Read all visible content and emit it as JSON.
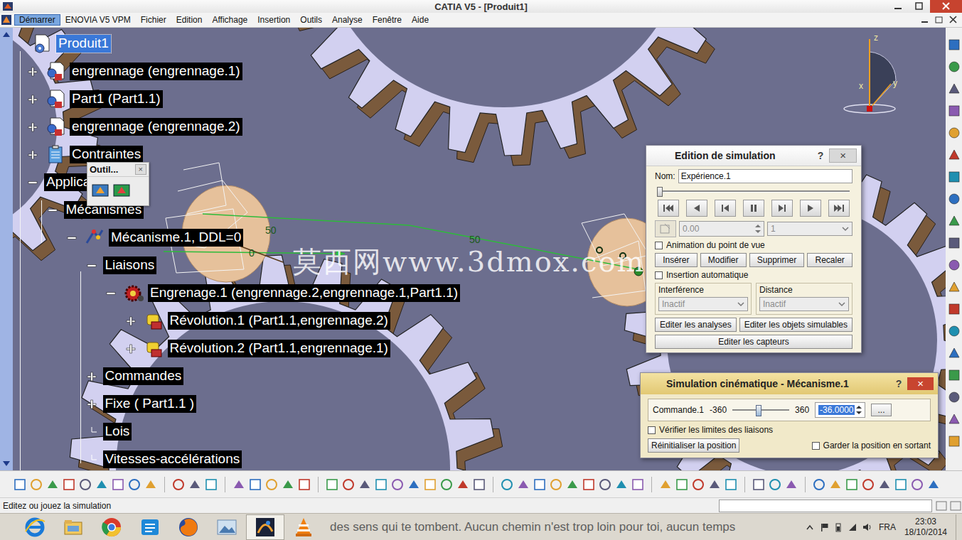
{
  "window": {
    "title": "CATIA V5 - [Produit1]"
  },
  "menu": [
    {
      "label": "Démarrer",
      "selected": true
    },
    {
      "label": "ENOVIA V5 VPM",
      "selected": false
    },
    {
      "label": "Fichier",
      "selected": false
    },
    {
      "label": "Edition",
      "selected": false
    },
    {
      "label": "Affichage",
      "selected": false
    },
    {
      "label": "Insertion",
      "selected": false
    },
    {
      "label": "Outils",
      "selected": false
    },
    {
      "label": "Analyse",
      "selected": false
    },
    {
      "label": "Fenêtre",
      "selected": false
    },
    {
      "label": "Aide",
      "selected": false
    }
  ],
  "tree": [
    {
      "label": "Produit1",
      "level": 0,
      "kind": "product",
      "expander": "none",
      "selected": true
    },
    {
      "label": "engrennage (engrennage.1)",
      "level": 1,
      "kind": "part",
      "expander": "plus",
      "selected": false
    },
    {
      "label": "Part1 (Part1.1)",
      "level": 1,
      "kind": "part",
      "expander": "plus",
      "selected": false
    },
    {
      "label": "engrennage (engrennage.2)",
      "level": 1,
      "kind": "part",
      "expander": "plus",
      "selected": false
    },
    {
      "label": "Contraintes",
      "level": 1,
      "kind": "constraints",
      "expander": "plus",
      "selected": false
    },
    {
      "label": "Applicat",
      "level": 1,
      "kind": "none",
      "expander": "minus",
      "selected": false
    },
    {
      "label": "Mécanismes",
      "level": 2,
      "kind": "none",
      "expander": "minus",
      "selected": false
    },
    {
      "label": "Mécanisme.1, DDL=0",
      "level": 3,
      "kind": "mechanism",
      "expander": "minus",
      "selected": false
    },
    {
      "label": "Liaisons",
      "level": 4,
      "kind": "none",
      "expander": "minus",
      "selected": false
    },
    {
      "label": "Engrenage.1 (engrennage.2,engrennage.1,Part1.1)",
      "level": 5,
      "kind": "gear-joint",
      "expander": "minus",
      "selected": false
    },
    {
      "label": "Révolution.1 (Part1.1,engrennage.2)",
      "level": 6,
      "kind": "revolute-joint",
      "expander": "plus",
      "selected": false
    },
    {
      "label": "Révolution.2 (Part1.1,engrennage.1)",
      "level": 6,
      "kind": "revolute-joint",
      "expander": "plus",
      "selected": false
    },
    {
      "label": "Commandes",
      "level": 4,
      "kind": "none",
      "expander": "plus",
      "selected": false
    },
    {
      "label": "Fixe ( Part1.1 )",
      "level": 4,
      "kind": "none",
      "expander": "plus",
      "selected": false
    },
    {
      "label": "Lois",
      "level": 4,
      "kind": "none",
      "expander": "none",
      "selected": false
    },
    {
      "label": "Vitesses-accélérations",
      "level": 4,
      "kind": "none",
      "expander": "none",
      "selected": false
    }
  ],
  "palette": {
    "title": "Outil...",
    "close": "×"
  },
  "viewport": {
    "watermark": "莫西网www.3dmox.com",
    "dimensions": [
      {
        "text": "50"
      },
      {
        "text": "50"
      },
      {
        "text": "0"
      }
    ],
    "axes": {
      "z": "z",
      "x": "x",
      "y": "y"
    }
  },
  "sim_editor": {
    "title": "Edition de simulation",
    "help": "?",
    "close": "×",
    "name_label": "Nom:",
    "name_value": "Expérience.1",
    "timeline_level": 0,
    "player": [
      {
        "kind": "first",
        "disabled": false
      },
      {
        "kind": "back",
        "disabled": false
      },
      {
        "kind": "stepback",
        "disabled": false
      },
      {
        "kind": "pause",
        "disabled": false
      },
      {
        "kind": "stepfwd",
        "disabled": false
      },
      {
        "kind": "play",
        "disabled": false
      },
      {
        "kind": "last",
        "disabled": false
      }
    ],
    "keyframe_disabled": true,
    "time": {
      "value": "0.00",
      "disabled": true
    },
    "step": {
      "value": "1",
      "disabled": true
    },
    "animate_view": {
      "label": "Animation du point de vue",
      "checked": false
    },
    "actions": [
      "Insérer",
      "Modifier",
      "Supprimer",
      "Recaler"
    ],
    "auto_insert": {
      "label": "Insertion automatique",
      "checked": false
    },
    "groups": [
      {
        "title": "Interférence",
        "value": "Inactif",
        "disabled": true
      },
      {
        "title": "Distance",
        "value": "Inactif",
        "disabled": true
      }
    ],
    "edit_buttons": [
      "Editer les analyses",
      "Editer les objets simulables"
    ],
    "sensors_button": "Editer les capteurs"
  },
  "kin_sim": {
    "title": "Simulation cinématique - Mécanisme.1",
    "help": "?",
    "close": "×",
    "command": {
      "label": "Commande.1",
      "min": "-360",
      "max": "360",
      "value": "-36.0000",
      "level": 0.45,
      "more": "..."
    },
    "check_limits": {
      "label": "Vérifier les limites des liaisons",
      "checked": false
    },
    "reset": "Réinitialiser la position",
    "keep": {
      "label": "Garder la position en sortant",
      "checked": false
    }
  },
  "status_bar": {
    "text": "Editez ou jouez la simulation"
  },
  "taskbar": {
    "marquee": "des sens qui te tombent. Aucun chemin n'est trop loin pour toi, aucun temps",
    "apps": [
      {
        "kind": "ie",
        "active": false
      },
      {
        "kind": "explorer",
        "active": false
      },
      {
        "kind": "chrome",
        "active": false
      },
      {
        "kind": "app",
        "active": false
      },
      {
        "kind": "firefox",
        "active": false
      },
      {
        "kind": "photos",
        "active": false
      },
      {
        "kind": "catia",
        "active": true
      },
      {
        "kind": "vlc",
        "active": false
      }
    ],
    "language": "FRA",
    "time": "23:03",
    "date": "18/10/2014"
  }
}
